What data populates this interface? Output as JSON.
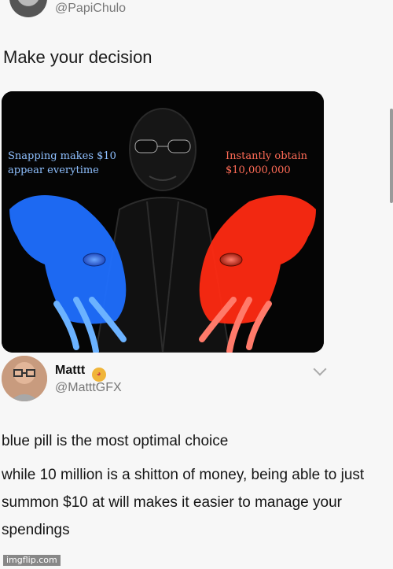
{
  "top_tweet": {
    "handle": "@PapiChulo",
    "text": "Make your decision"
  },
  "meme": {
    "blue_caption": "Snapping makes $10\nappear everytime",
    "red_caption": "Instantly obtain\n$10,000,000"
  },
  "reply": {
    "name": "Mattt",
    "handle": "@MatttGFX",
    "emoji_icon": "cat-emoji-icon",
    "para1": "blue pill is the most optimal choice",
    "para2": "while 10 million is a shitton of money, being able to just summon $10 at will makes it easier to manage your spendings"
  },
  "watermark": "imgflip.com",
  "colors": {
    "blue_hand": "#2b8cff",
    "red_hand": "#ff2a12",
    "bg": "#f7f7f7"
  }
}
